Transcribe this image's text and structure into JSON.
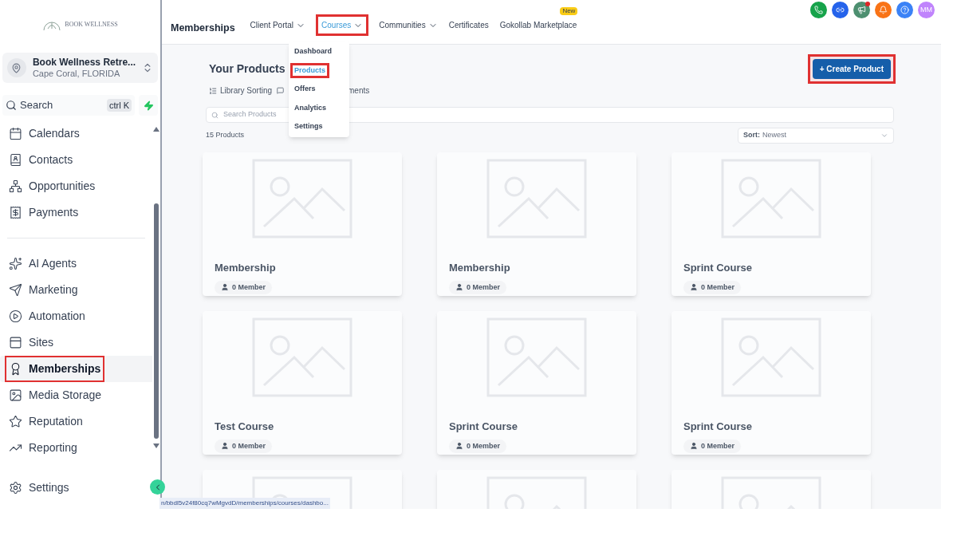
{
  "sidebar": {
    "logo_text": "BOOK WELLNESS",
    "account": {
      "name": "Book Wellness Retre...",
      "location": "Cape Coral, FLORIDA"
    },
    "search": {
      "placeholder": "Search",
      "shortcut": "ctrl K"
    },
    "sections": [
      [
        {
          "label": "Calendars",
          "highlighted": false
        },
        {
          "label": "Contacts",
          "highlighted": false
        },
        {
          "label": "Opportunities",
          "highlighted": false
        },
        {
          "label": "Payments",
          "highlighted": false
        }
      ],
      [
        {
          "label": "AI Agents",
          "highlighted": false
        },
        {
          "label": "Marketing",
          "highlighted": false
        },
        {
          "label": "Automation",
          "highlighted": false
        },
        {
          "label": "Sites",
          "highlighted": false
        },
        {
          "label": "Memberships",
          "highlighted": true
        },
        {
          "label": "Media Storage",
          "highlighted": false
        },
        {
          "label": "Reputation",
          "highlighted": false
        },
        {
          "label": "Reporting",
          "highlighted": false
        }
      ]
    ],
    "settings": "Settings"
  },
  "topbar": {
    "title": "Memberships",
    "tabs": [
      {
        "label": "Client Portal",
        "dropdown": true,
        "selected": false,
        "highlighted": false
      },
      {
        "label": "Courses",
        "dropdown": true,
        "selected": true,
        "highlighted": true
      },
      {
        "label": "Communities",
        "dropdown": true,
        "selected": false,
        "highlighted": false
      },
      {
        "label": "Certificates",
        "dropdown": false,
        "selected": false,
        "highlighted": false
      },
      {
        "label": "Gokollab Marketplace",
        "dropdown": false,
        "selected": false,
        "highlighted": false,
        "badge": "New"
      }
    ],
    "avatar": "MM"
  },
  "courses_menu": [
    {
      "label": "Dashboard",
      "selected": false,
      "highlighted": false
    },
    {
      "label": "Products",
      "selected": true,
      "highlighted": true
    },
    {
      "label": "Offers",
      "selected": false,
      "highlighted": false
    },
    {
      "label": "Analytics",
      "selected": false,
      "highlighted": false
    },
    {
      "label": "Settings",
      "selected": false,
      "highlighted": false
    }
  ],
  "page": {
    "title": "Your Products",
    "links": [
      "Library Sorting",
      "ments"
    ],
    "create_button": {
      "label": "+ Create Product",
      "highlighted": true
    },
    "search_placeholder": "Search Products",
    "count": "15 Products",
    "sort_label": "Sort:",
    "sort_value": "Newest",
    "products": [
      {
        "kind": "full",
        "title": "Membership",
        "members": "0 Member"
      },
      {
        "kind": "full",
        "title": "Membership",
        "members": "0 Member"
      },
      {
        "kind": "full",
        "title": "Sprint Course",
        "members": "0 Member"
      },
      {
        "kind": "full",
        "title": "Test Course",
        "members": "0 Member"
      },
      {
        "kind": "full",
        "title": "Sprint Course",
        "members": "0 Member"
      },
      {
        "kind": "full",
        "title": "Sprint Course",
        "members": "0 Member"
      },
      {
        "kind": "image_only"
      },
      {
        "kind": "image_only"
      },
      {
        "kind": "image_only"
      }
    ]
  },
  "status_url": "n/bbdl5v24f80cq7wMgvdD/memberships/courses/dashbo..."
}
